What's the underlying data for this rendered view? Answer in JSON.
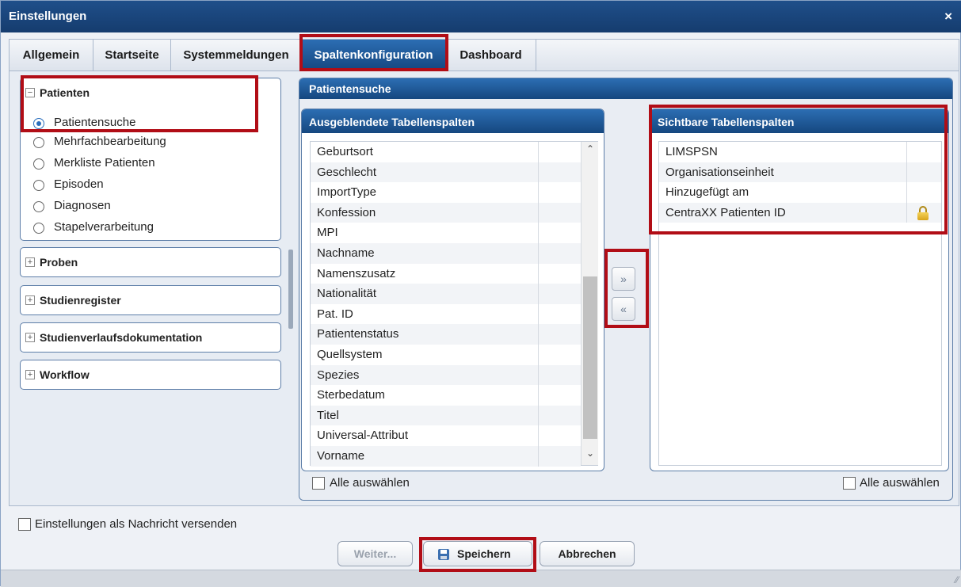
{
  "window": {
    "title": "Einstellungen",
    "close_glyph": "×"
  },
  "tabs": [
    {
      "label": "Allgemein"
    },
    {
      "label": "Startseite"
    },
    {
      "label": "Systemmeldungen"
    },
    {
      "label": "Spaltenkonfiguration",
      "active": true
    },
    {
      "label": "Dashboard"
    }
  ],
  "sidebar": {
    "patienten": {
      "header": "Patienten",
      "items": [
        {
          "label": "Patientensuche",
          "checked": true
        },
        {
          "label": "Mehrfachbearbeitung"
        },
        {
          "label": "Merkliste Patienten"
        },
        {
          "label": "Episoden"
        },
        {
          "label": "Diagnosen"
        },
        {
          "label": "Stapelverarbeitung"
        }
      ]
    },
    "sections": [
      {
        "label": "Proben"
      },
      {
        "label": "Studienregister"
      },
      {
        "label": "Studienverlaufsdokumentation"
      },
      {
        "label": "Workflow"
      }
    ]
  },
  "main": {
    "panel_title": "Patientensuche",
    "hidden": {
      "title": "Ausgeblendete Tabellenspalten",
      "items": [
        "Geburtsort",
        "Geschlecht",
        "ImportType",
        "Konfession",
        "MPI",
        "Nachname",
        "Namenszusatz",
        "Nationalität",
        "Pat. ID",
        "Patientenstatus",
        "Quellsystem",
        "Spezies",
        "Sterbedatum",
        "Titel",
        "Universal-Attribut",
        "Vorname"
      ],
      "select_all": "Alle auswählen"
    },
    "visible": {
      "title": "Sichtbare Tabellenspalten",
      "items": [
        "LIMSPSN",
        "Organisationseinheit",
        "Hinzugefügt am",
        "CentraXX Patienten ID"
      ],
      "locked_item": "CentraXX Patienten ID",
      "select_all": "Alle auswählen"
    },
    "move_right_glyph": "»",
    "move_left_glyph": "«"
  },
  "footer": {
    "send_as_message": "Einstellungen als Nachricht versenden",
    "buttons": {
      "next": "Weiter...",
      "save": "Speichern",
      "cancel": "Abbrechen"
    }
  },
  "colors": {
    "header_blue": "#1f4f8a",
    "highlight_red": "#b10d16",
    "radio_blue": "#2a6ebd"
  }
}
